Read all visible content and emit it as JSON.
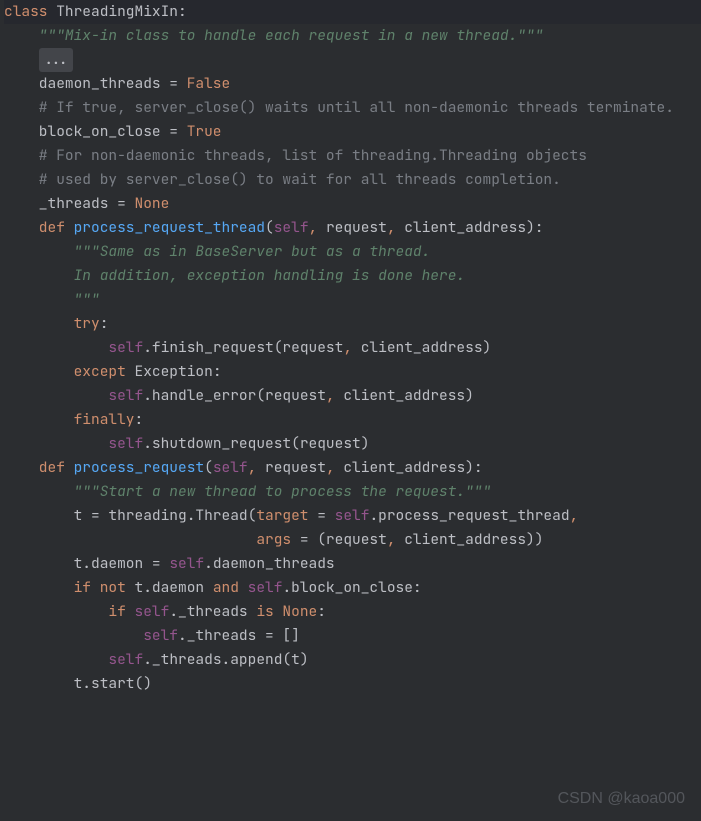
{
  "code": {
    "l1_class": "class",
    "l1_name": " ThreadingMixIn",
    "l1_colon": ":",
    "l2_doc": "    \"\"\"Mix-in class to handle each request in a new thread.\"\"\"",
    "l3": "",
    "l4_ellipsis": "...",
    "l5": "    daemon_threads = ",
    "l5_val": "False",
    "l6": "    # If true, server_close() waits until all non-daemonic threads terminate.",
    "l7": "    block_on_close = ",
    "l7_val": "True",
    "l8": "    # For non-daemonic threads, list of threading.Threading objects",
    "l9": "    # used by server_close() to wait for all threads completion.",
    "l10": "    _threads = ",
    "l10_val": "None",
    "l11": "",
    "l12_def": "    def ",
    "l12_name": "process_request_thread",
    "l12_paren_open": "(",
    "l12_self": "self",
    "l12_c1": ", ",
    "l12_p1": "request",
    "l12_c2": ", ",
    "l12_p2": "client_address",
    "l12_close": "):",
    "l13_doc": "        \"\"\"Same as in BaseServer but as a thread.",
    "l14_doc": "",
    "l15_doc": "        In addition, exception handling is done here.",
    "l16_doc": "",
    "l17_doc": "        \"\"\"",
    "l18_try": "        try",
    "l18_colon": ":",
    "l19_indent": "            ",
    "l19_self": "self",
    "l19_rest": ".finish_request(request",
    "l19_c": ", ",
    "l19_rest2": "client_address)",
    "l20_except": "        except ",
    "l20_exc": "Exception",
    "l20_colon": ":",
    "l21_indent": "            ",
    "l21_self": "self",
    "l21_rest": ".handle_error(request",
    "l21_c": ", ",
    "l21_rest2": "client_address)",
    "l22_finally": "        finally",
    "l22_colon": ":",
    "l23_indent": "            ",
    "l23_self": "self",
    "l23_rest": ".shutdown_request(request)",
    "l24": "",
    "l25_def": "    def ",
    "l25_name": "process_request",
    "l25_paren_open": "(",
    "l25_self": "self",
    "l25_c1": ", ",
    "l25_p1": "request",
    "l25_c2": ", ",
    "l25_p2": "client_address",
    "l25_close": "):",
    "l26_doc": "        \"\"\"Start a new thread to process the request.\"\"\"",
    "l27_pre": "        t = threading.Thread(",
    "l27_target": "target",
    "l27_eq": " = ",
    "l27_self": "self",
    "l27_rest": ".process_request_thread",
    "l27_c": ",",
    "l28_pre": "                             ",
    "l28_args": "args",
    "l28_eq": " = (request",
    "l28_c": ", ",
    "l28_rest": "client_address))",
    "l29_pre": "        t.daemon = ",
    "l29_self": "self",
    "l29_rest": ".daemon_threads",
    "l30_if": "        if not ",
    "l30_mid1": "t.daemon ",
    "l30_and": "and ",
    "l30_self": "self",
    "l30_rest": ".block_on_close:",
    "l31_if": "            if ",
    "l31_self": "self",
    "l31_mid": "._threads ",
    "l31_is": "is ",
    "l31_none": "None",
    "l31_colon": ":",
    "l32_pre": "                ",
    "l32_self": "self",
    "l32_rest": "._threads = []",
    "l33_pre": "            ",
    "l33_self": "self",
    "l33_rest": "._threads.append(t)",
    "l34": "        t.start()"
  },
  "watermark": "CSDN @kaoa000"
}
